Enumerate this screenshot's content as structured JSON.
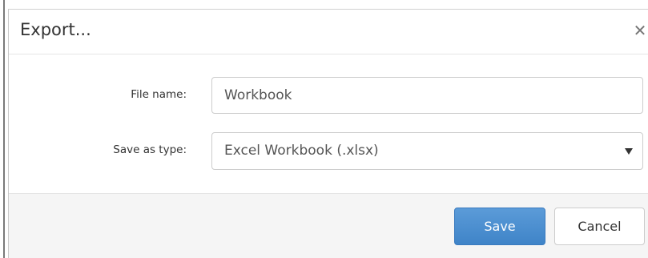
{
  "dialog": {
    "title": "Export...",
    "close_icon": "close-icon"
  },
  "form": {
    "file_name_label": "File name:",
    "file_name_value": "Workbook",
    "save_as_type_label": "Save as type:",
    "save_as_type_value": "Excel Workbook (.xlsx)"
  },
  "footer": {
    "save_label": "Save",
    "cancel_label": "Cancel"
  },
  "colors": {
    "primary_button": "#4a90d2",
    "footer_background": "#f5f5f5",
    "border": "#cccccc"
  }
}
